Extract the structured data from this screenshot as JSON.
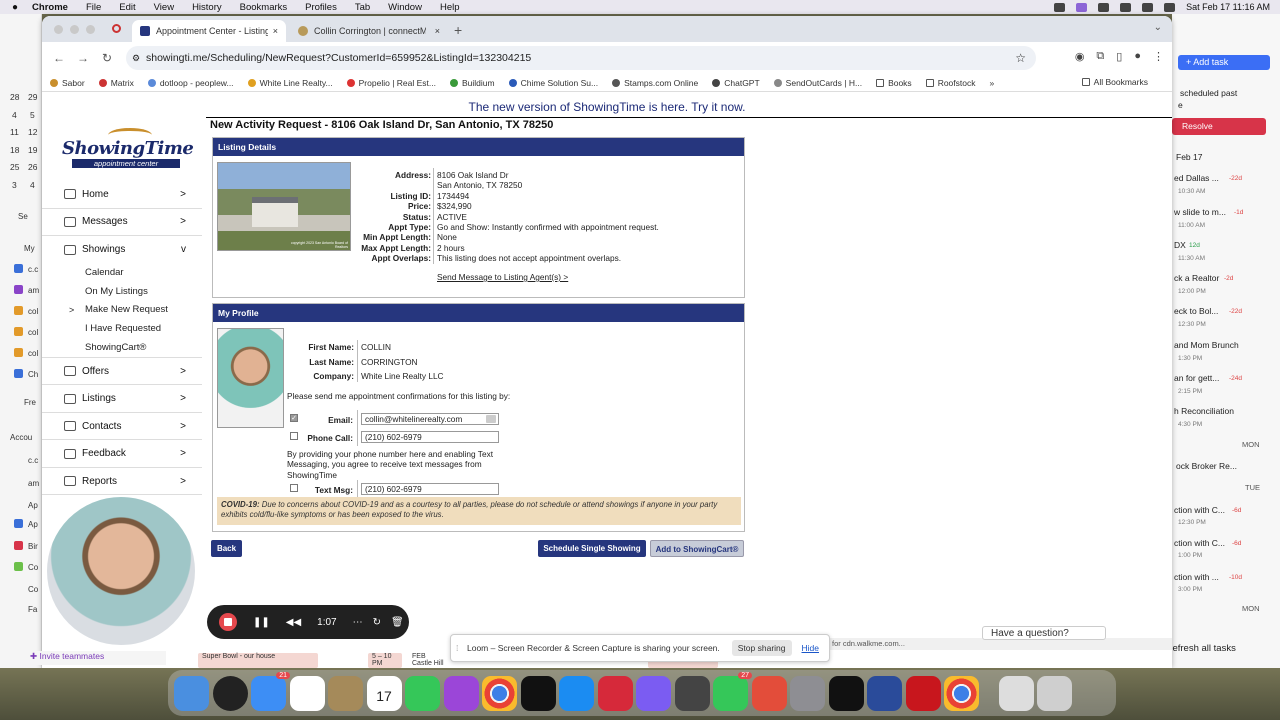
{
  "menubar": {
    "apple": "",
    "app": "Chrome",
    "items": [
      "File",
      "Edit",
      "View",
      "History",
      "Bookmarks",
      "Profiles",
      "Tab",
      "Window",
      "Help"
    ],
    "datetime": "Sat Feb 17  11:16 AM"
  },
  "browser": {
    "tabs": [
      {
        "label": "Appointment Center - Listing"
      },
      {
        "label": "Collin Corrington | connectM"
      }
    ],
    "tab_close": "×",
    "new_tab": "+",
    "tab_menu": "⌄",
    "url": "showingti.me/Scheduling/NewRequest?CustomerId=659952&ListingId=132304215",
    "nav": {
      "back": "←",
      "forward": "→",
      "reload": "↻"
    },
    "bookmarks": [
      "Sabor",
      "Matrix",
      "dotloop - peoplew...",
      "White Line Realty...",
      "Propelio | Real Est...",
      "Buildium",
      "Chime Solution Su...",
      "Stamps.com Online",
      "ChatGPT",
      "SendOutCards | H...",
      "Books",
      "Roofstock"
    ],
    "bookmarks_more": "»",
    "all_bookmarks": "All Bookmarks"
  },
  "banner": "The new version of ShowingTime is here. Try it now.",
  "logo": {
    "name": "ShowingTime",
    "tagline": "appointment center"
  },
  "sidebar": {
    "main": [
      {
        "label": "Home",
        "arrow": ">"
      },
      {
        "label": "Messages",
        "arrow": ">"
      },
      {
        "label": "Showings",
        "arrow": "v"
      }
    ],
    "sub": [
      {
        "label": "Calendar",
        "arrow": ""
      },
      {
        "label": "On My Listings",
        "arrow": ""
      },
      {
        "label": "Make New Request",
        "arrow": ">"
      },
      {
        "label": "I Have Requested",
        "arrow": ""
      },
      {
        "label": "ShowingCart®",
        "arrow": ""
      }
    ],
    "main2": [
      {
        "label": "Offers",
        "arrow": ">"
      },
      {
        "label": "Listings",
        "arrow": ">"
      },
      {
        "label": "Contacts",
        "arrow": ">"
      },
      {
        "label": "Feedback",
        "arrow": ">"
      },
      {
        "label": "Reports",
        "arrow": ">"
      }
    ]
  },
  "page_title": "New Activity Request - 8106 Oak Island Dr, San Antonio, TX 78250",
  "listing": {
    "header": "Listing Details",
    "photo_caption": "copyright 2023 San Antonio Board of Realtors",
    "fields": [
      {
        "label": "Address:",
        "value": "8106 Oak Island Dr",
        "value2": "San Antonio, TX 78250"
      },
      {
        "label": "Listing ID:",
        "value": "1734494"
      },
      {
        "label": "Price:",
        "value": "$324,990"
      },
      {
        "label": "Status:",
        "value": "ACTIVE"
      },
      {
        "label": "Appt Type:",
        "value": "Go and Show: Instantly confirmed with appointment request."
      },
      {
        "label": "Min Appt Length:",
        "value": "None"
      },
      {
        "label": "Max Appt Length:",
        "value": "2 hours"
      },
      {
        "label": "Appt Overlaps:",
        "value": "This listing does not accept appointment overlaps."
      }
    ],
    "send_message": "Send Message to Listing Agent(s) >"
  },
  "profile": {
    "header": "My Profile",
    "first_name_label": "First Name:",
    "first_name": "COLLIN",
    "last_name_label": "Last Name:",
    "last_name": "CORRINGTON",
    "company_label": "Company:",
    "company": "White Line Realty LLC",
    "confirm_text": "Please send me appointment confirmations for this listing by:",
    "email_label": "Email:",
    "email": "collin@whitelinerealty.com",
    "email_checked": "✓",
    "phone_label": "Phone Call:",
    "phone": "(210) 602-6979",
    "sms_notice": "By providing your phone number here and enabling Text Messaging, you agree to receive text messages from ShowingTime",
    "text_label": "Text Msg:",
    "text": "(210) 602-6979",
    "covid_bold": "COVID-19:",
    "covid": "Due to concerns about COVID-19 and as a courtesy to all parties, please do not schedule or attend showings if anyone in your party exhibits cold/flu-like symptoms or has been exposed to the virus."
  },
  "buttons": {
    "back": "Back",
    "schedule": "Schedule Single Showing",
    "add_cart": "Add to ShowingCart®"
  },
  "loom": {
    "time": "1:07",
    "share_text": "Loom – Screen Recorder & Screen Capture is sharing your screen.",
    "stop": "Stop sharing",
    "hide": "Hide",
    "pause": "❚❚",
    "rewind": "◀◀",
    "grid": "⋯",
    "restart": "↻",
    "trash": "🗑"
  },
  "status_url": "for cdn.walkme.com...",
  "question": "Have a question?",
  "tasks_panel": {
    "add_task": "Add task",
    "notice": "scheduled past",
    "notice2": "e",
    "resolve": "Resolve",
    "date": "Feb 17",
    "items": [
      {
        "title": "ed Dallas ...",
        "time": "10:30 AM",
        "tag": "-22d"
      },
      {
        "title": "w slide to m...",
        "time": "11:00 AM",
        "tag": "-1d"
      },
      {
        "title": "DX",
        "time": "11:30 AM",
        "tag": "12d"
      },
      {
        "title": "ck a Realtor",
        "time": "12:00 PM",
        "tag": "-2d"
      },
      {
        "title": "eck to Bol...",
        "time": "12:30 PM",
        "tag": "-22d"
      },
      {
        "title": "and Mom Brunch",
        "time": "1:30 PM",
        "tag": ""
      },
      {
        "title": "an for gett...",
        "time": "2:15 PM",
        "tag": "-24d"
      },
      {
        "title": "h Reconciliation",
        "time": "4:30 PM",
        "tag": ""
      }
    ],
    "mon": "MON",
    "mon_item": "ock Broker Re...",
    "tue": "TUE",
    "tue_items": [
      {
        "title": "ction with C...",
        "time": "12:30 PM",
        "tag": "-6d"
      },
      {
        "title": "ction with C...",
        "time": "1:00 PM",
        "tag": "-6d"
      },
      {
        "title": "ction with ...",
        "time": "3:00 PM",
        "tag": "-10d"
      }
    ],
    "mon2": "MON",
    "refresh": "Refresh all tasks"
  },
  "left_panel": {
    "cal_rows": [
      [
        "28",
        "29"
      ],
      [
        "4",
        "5"
      ],
      [
        "11",
        "12"
      ],
      [
        "18",
        "19"
      ],
      [
        "25",
        "26"
      ],
      [
        "3",
        "4"
      ]
    ],
    "search": "Se",
    "my": "My",
    "items": [
      "c.c",
      "am",
      "col",
      "col",
      "col",
      "Ch"
    ],
    "fre": "Fre",
    "accounts": "Accou",
    "acc_items": [
      "c.c",
      "am",
      "Ap",
      "Ap",
      "Bir",
      "Co",
      "Co",
      "Fa"
    ]
  },
  "invite": "Invite teammates",
  "calendar_events": [
    {
      "title": "Super Bowl - our house"
    },
    {
      "title": "5 – 10 PM"
    },
    {
      "title": "FEB Castle Hill"
    },
    {
      "title": "Castle Hills Party"
    }
  ],
  "dock": {
    "badges": {
      "mail": "21",
      "calendar_day": "17",
      "messages": "27"
    }
  }
}
